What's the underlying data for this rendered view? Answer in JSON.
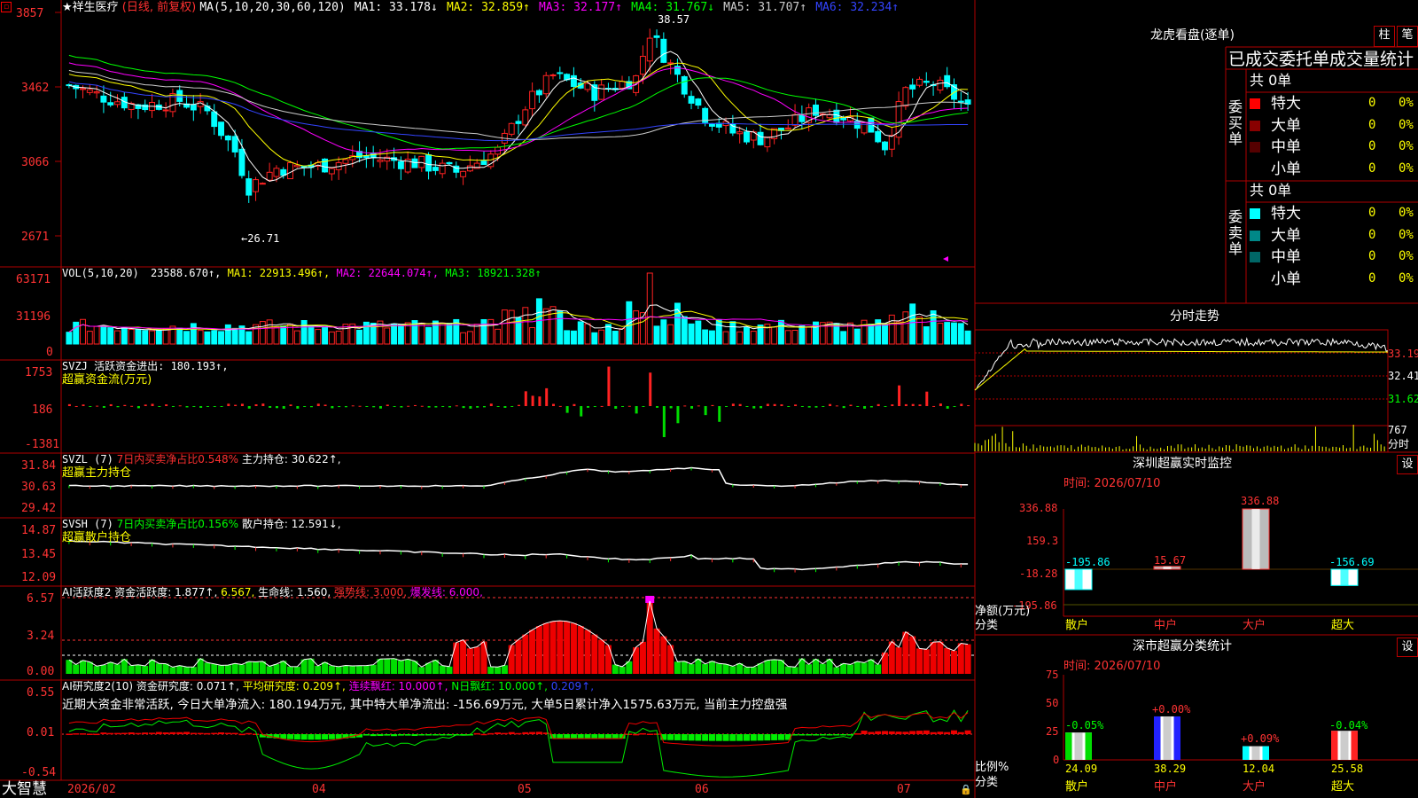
{
  "colors": {
    "up": "#ff2222",
    "down": "#00ffff",
    "grid": "#b00000",
    "axisText": "#ff3333",
    "ma1": "#ffffff",
    "ma2": "#ffff00",
    "ma3": "#ff00ff",
    "ma4": "#00ff00",
    "ma5": "#cccccc",
    "ma6": "#3344ff"
  },
  "chart": {
    "stock_name": "★祥生医疗",
    "mode_label": "(日线, 前复权)",
    "ma_header": "MA(5,10,20,30,60,120)",
    "ma_items": [
      {
        "label": "MA1: 33.178↓",
        "color": "#ffffff"
      },
      {
        "label": "MA2: 32.859↑",
        "color": "#ffff00"
      },
      {
        "label": "MA3: 32.177↑",
        "color": "#ff00ff"
      },
      {
        "label": "MA4: 31.767↓",
        "color": "#00ff00"
      },
      {
        "label": "MA5: 31.707↑",
        "color": "#cccccc"
      },
      {
        "label": "MA6: 32.234↑",
        "color": "#3344ff"
      }
    ],
    "price_axis": [
      "3857",
      "3462",
      "3066",
      "2671"
    ],
    "high_label": "38.57",
    "low_label": "←26.71",
    "date_labels": [
      "2026/02",
      "04",
      "05",
      "06",
      "07"
    ]
  },
  "vol": {
    "header": "VOL(5,10,20)",
    "value": "23588.670↑,",
    "ma1": "MA1: 22913.496↑,",
    "ma2": "MA2: 22644.074↑,",
    "ma3": "MA3: 18921.328↑",
    "axis": [
      "63171",
      "31196",
      "0"
    ]
  },
  "svzj": {
    "header": "SVZJ  活跃资金进出: 180.193↑,",
    "subtitle": "超赢资金流(万元)",
    "axis": [
      "1753",
      "186",
      "-1381"
    ]
  },
  "svzl": {
    "header1": "SVZL (7)",
    "header2": "7日内买卖净占比0.548%",
    "header3": "主力持仓: 30.622↑,",
    "subtitle": "超赢主力持仓",
    "axis": [
      "31.84",
      "30.63",
      "29.42"
    ]
  },
  "svsh": {
    "header1": "SVSH (7)",
    "header2": "7日内买卖净占比0.156%",
    "header3": "散户持仓: 12.591↓,",
    "subtitle": "超赢散户持仓",
    "axis": [
      "14.87",
      "13.45",
      "12.09"
    ]
  },
  "ai_active": {
    "header1": "AI活跃度2",
    "header2": "资金活跃度: 1.877↑,",
    "header3": "6.567,",
    "header4": "生命线: 1.560,",
    "header5": "强势线: 3.000,",
    "header6": "爆发线: 6.000,",
    "axis": [
      "6.57",
      "3.24",
      "0.00"
    ]
  },
  "ai_research": {
    "header1": "AI研究度2(10)",
    "header2": "资金研究度: 0.071↑,",
    "header3": "平均研究度: 0.209↑,",
    "header4": "连续飘红: 10.000↑,",
    "header5": "N日飘红: 10.000↑,",
    "header6": "0.209↑,",
    "comment": "近期大资金非常活跃, 今日大单净流入: 180.194万元, 其中特大单净流出: -156.69万元, 大单5日累计净入1575.63万元, 当前主力控盘强",
    "axis": [
      "0.55",
      "0.01",
      "-0.54"
    ]
  },
  "bottom": {
    "brand": "大智慧"
  },
  "dragon": {
    "title": "龙虎看盘(逐单)",
    "btn_col": "柱",
    "btn_bi": "笔",
    "tab_title": "已成交委托单成交量统计",
    "buy_label": "委买单",
    "sell_label": "委卖单",
    "buy_total": "共 0单",
    "sell_total": "共 0单",
    "buy_rows": [
      {
        "name": "特大",
        "count": "0",
        "pct": "0%",
        "color": "#ff0000"
      },
      {
        "name": "大单",
        "count": "0",
        "pct": "0%",
        "color": "#880000"
      },
      {
        "name": "中单",
        "count": "0",
        "pct": "0%",
        "color": "#550000"
      },
      {
        "name": "小单",
        "count": "0",
        "pct": "0%",
        "color": "#000000"
      }
    ],
    "sell_rows": [
      {
        "name": "特大",
        "count": "0",
        "pct": "0%",
        "color": "#00ffff"
      },
      {
        "name": "大单",
        "count": "0",
        "pct": "0%",
        "color": "#008888"
      },
      {
        "name": "中单",
        "count": "0",
        "pct": "0%",
        "color": "#006666"
      },
      {
        "name": "小单",
        "count": "0",
        "pct": "0%",
        "color": "#000000"
      }
    ]
  },
  "intraday": {
    "title": "分时走势",
    "axis": [
      "33.19",
      "32.41",
      "31.62"
    ],
    "vol_label": "767",
    "vol_unit": "分时"
  },
  "monitor": {
    "title": "深圳超赢实时监控",
    "btn": "设",
    "date": "时间: 2026/07/10",
    "axis": [
      "336.88",
      "159.3",
      "-18.28",
      "-195.86"
    ],
    "row_label1": "净额(万元)",
    "row_label2": "分类",
    "categories": [
      "散户",
      "中户",
      "大户",
      "超大"
    ],
    "values": [
      -195.86,
      15.67,
      336.88,
      -156.69
    ],
    "value_labels": [
      "-195.86",
      "15.67",
      "336.88",
      "-156.69"
    ]
  },
  "classify": {
    "title": "深市超赢分类统计",
    "btn": "设",
    "date": "时间: 2026/07/10",
    "axis": [
      "75",
      "50",
      "25",
      "0"
    ],
    "row_label1": "比例%",
    "row_label2": "分类",
    "categories": [
      "散户",
      "中户",
      "大户",
      "超大"
    ],
    "values": [
      24.09,
      38.29,
      12.04,
      25.58
    ],
    "value_labels": [
      "24.09",
      "38.29",
      "12.04",
      "25.58"
    ],
    "delta_labels": [
      "-0.05%",
      "+0.00%",
      "+0.09%",
      "-0.04%"
    ]
  }
}
